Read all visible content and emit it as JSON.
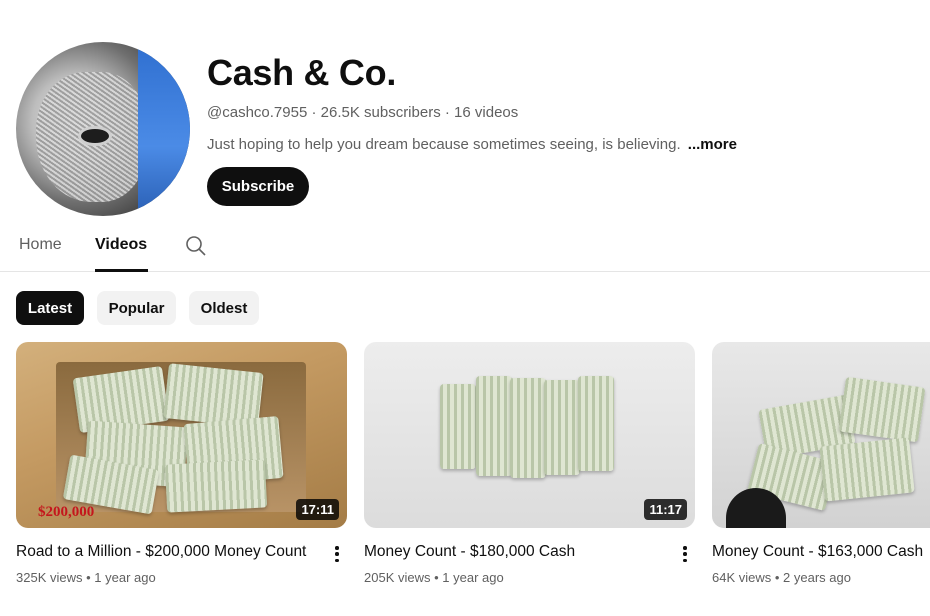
{
  "channel": {
    "name": "Cash & Co.",
    "handle": "@cashco.7955",
    "separator1": " · ",
    "subscribers": "26.5K subscribers",
    "separator2": " · ",
    "video_count": "16 videos",
    "description": "Just hoping to help you dream because sometimes seeing, is believing.",
    "more_label": "...more",
    "subscribe_label": "Subscribe",
    "avatar_icon": "banknote-portrait-avatar"
  },
  "tabs": [
    {
      "label": "Home",
      "active": false
    },
    {
      "label": "Videos",
      "active": true
    }
  ],
  "search_icon": "search-icon",
  "chips": [
    {
      "label": "Latest",
      "active": true
    },
    {
      "label": "Popular",
      "active": false
    },
    {
      "label": "Oldest",
      "active": false
    }
  ],
  "videos": [
    {
      "title": "Road to a Million - $200,000 Money Count",
      "views": "325K views",
      "age": "1 year ago",
      "duration": "17:11",
      "thumb_text": "$200,000"
    },
    {
      "title": "Money Count - $180,000 Cash",
      "views": "205K views",
      "age": "1 year ago",
      "duration": "11:17"
    },
    {
      "title": "Money Count - $163,000 Cash",
      "views": "64K views",
      "age": "2 years ago",
      "duration": ""
    }
  ],
  "meta_separator": " • ",
  "colors": {
    "primary_text": "#0f0f0f",
    "secondary_text": "#606060",
    "chip_bg": "#f2f2f2",
    "price_tag": "#c4161c"
  }
}
